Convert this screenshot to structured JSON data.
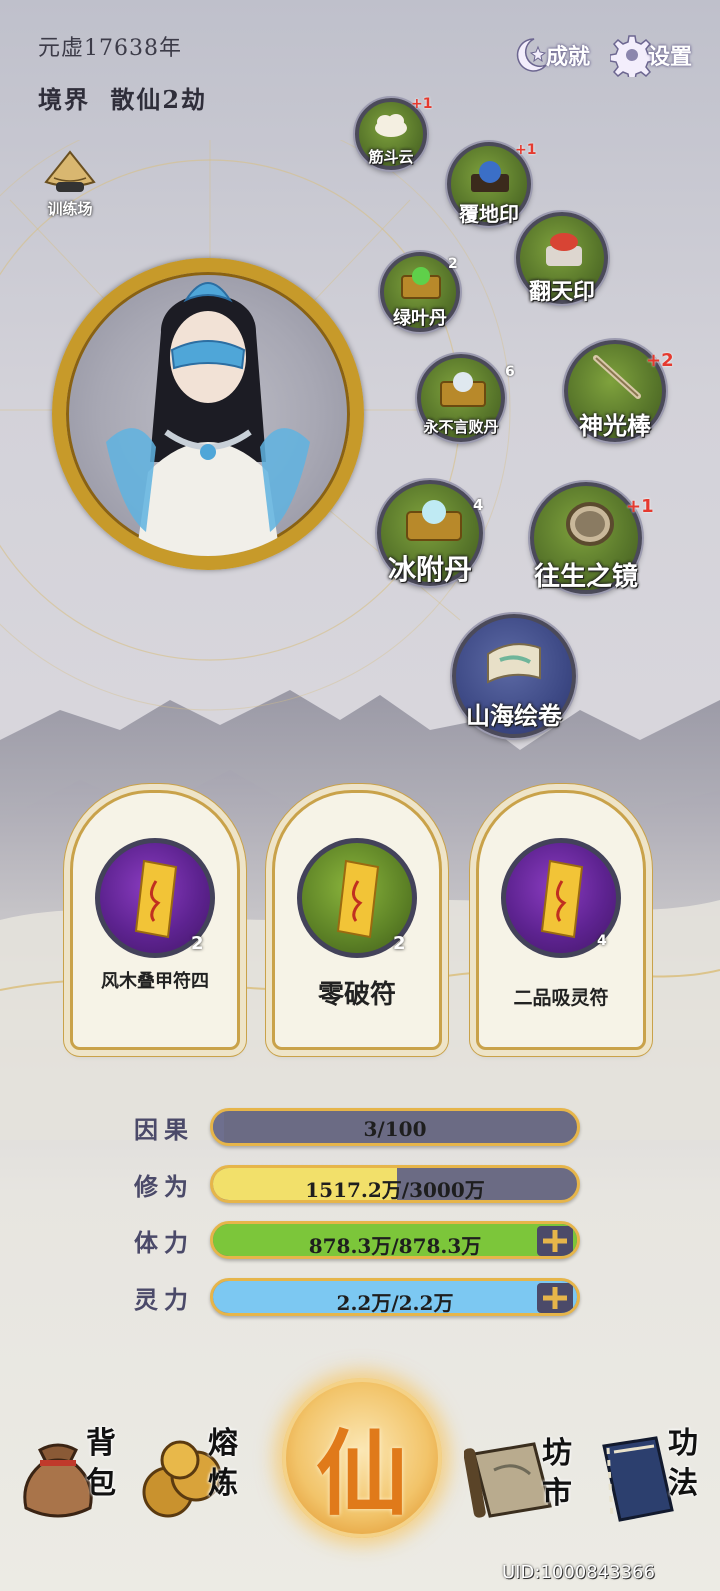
{
  "header": {
    "year": "元虚17638年",
    "realm_label": "境界",
    "realm_value": "散仙2劫",
    "achievements_label": "成就",
    "settings_label": "设置"
  },
  "training_label": "训练场",
  "items": [
    {
      "name": "筋斗云",
      "badge": "+1"
    },
    {
      "name": "覆地印",
      "badge": "+1"
    },
    {
      "name": "翻天印",
      "badge": ""
    },
    {
      "name": "绿叶丹",
      "badge": "2"
    },
    {
      "name": "永不言败丹",
      "badge": "6"
    },
    {
      "name": "神光棒",
      "badge": "+2"
    },
    {
      "name": "冰附丹",
      "badge": "4"
    },
    {
      "name": "往生之镜",
      "badge": "+1"
    },
    {
      "name": "山海绘卷",
      "badge": ""
    }
  ],
  "talismans": [
    {
      "name": "风木叠甲符四",
      "count": "2"
    },
    {
      "name": "零破符",
      "count": "2"
    },
    {
      "name": "二品吸灵符",
      "count": "4"
    }
  ],
  "stats": [
    {
      "label": "因果",
      "text": "3/100",
      "fill": 0.03,
      "color": "#6e6f8e"
    },
    {
      "label": "修为",
      "text": "1517.2万/3000万",
      "fill": 0.506,
      "color": "#f2e06a"
    },
    {
      "label": "体力",
      "text": "878.3万/878.3万",
      "fill": 1.0,
      "color": "#7cc63a"
    },
    {
      "label": "灵力",
      "text": "2.2万/2.2万",
      "fill": 1.0,
      "color": "#7cc8f2"
    }
  ],
  "nav": {
    "bag": "背包",
    "refine": "熔炼",
    "center": "仙",
    "market": "坊市",
    "skills": "功法"
  },
  "uid": "UID:1000843366",
  "colors": {
    "gold": "#c9a24a",
    "item_green": "#57752a",
    "talisman_purple": "#5e2391"
  }
}
